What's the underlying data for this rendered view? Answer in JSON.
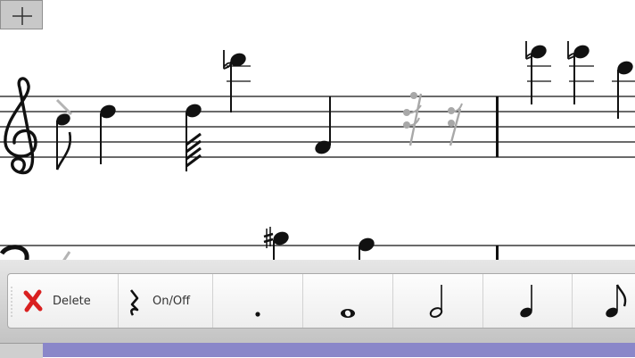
{
  "toolbar": {
    "delete_label": "Delete",
    "rest_toggle_label": "On/Off",
    "accent_red": "#d92020",
    "items": [
      {
        "id": "delete",
        "icon": "red-x-icon"
      },
      {
        "id": "rest-toggle",
        "icon": "quarter-rest-icon"
      },
      {
        "id": "dot",
        "icon": "dot-icon"
      },
      {
        "id": "whole",
        "icon": "whole-note-icon"
      },
      {
        "id": "half",
        "icon": "half-note-icon"
      },
      {
        "id": "quarter",
        "icon": "quarter-note-icon"
      },
      {
        "id": "eighth",
        "icon": "eighth-note-icon"
      }
    ]
  },
  "score": {
    "staves": [
      "treble-staff",
      "bass-staff"
    ],
    "ghost_color": "#b4b4b4"
  }
}
